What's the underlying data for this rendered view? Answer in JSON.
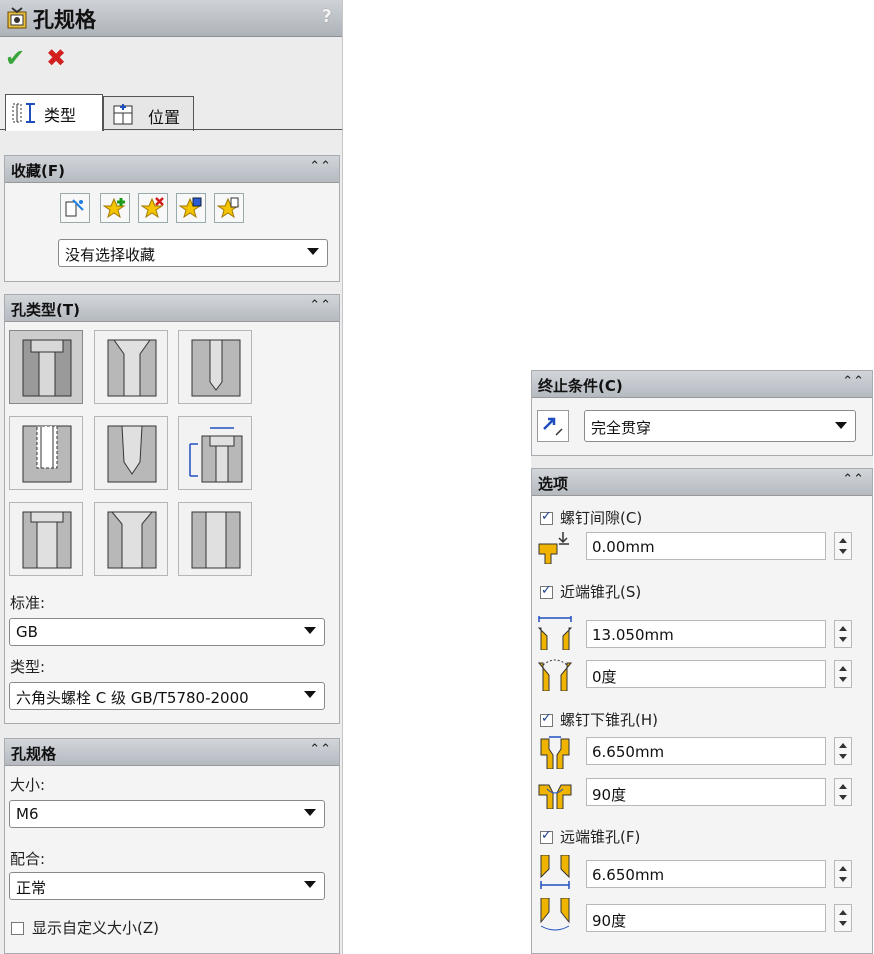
{
  "title": "孔规格",
  "help": "?",
  "tabs": [
    {
      "label": "类型"
    },
    {
      "label": "位置"
    }
  ],
  "favorites": {
    "title": "收藏(F)",
    "select_value": "没有选择收藏"
  },
  "hole_type": {
    "title": "孔类型(T)",
    "standard_label": "标准:",
    "standard_value": "GB",
    "type_label": "类型:",
    "type_value": "六角头螺栓 C 级 GB/T5780-2000"
  },
  "hole_spec": {
    "title": "孔规格",
    "size_label": "大小:",
    "size_value": "M6",
    "fit_label": "配合:",
    "fit_value": "正常",
    "custom_size_label": "显示自定义大小(Z)",
    "custom_size_checked": false
  },
  "end_condition": {
    "title": "终止条件(C)",
    "value": "完全贯穿"
  },
  "options": {
    "title": "选项",
    "head_clearance_label": "螺钉间隙(C)",
    "head_clearance_checked": true,
    "head_clearance_value": "0.00mm",
    "near_csk_label": "近端锥孔(S)",
    "near_csk_checked": true,
    "near_csk_dia": "13.050mm",
    "near_csk_angle": "0度",
    "under_head_csk_label": "螺钉下锥孔(H)",
    "under_head_csk_checked": true,
    "under_head_csk_dia": "6.650mm",
    "under_head_csk_angle": "90度",
    "far_csk_label": "远端锥孔(F)",
    "far_csk_checked": true,
    "far_csk_dia": "6.650mm",
    "far_csk_angle": "90度"
  },
  "colors": {
    "accent_yellow": "#f0b400",
    "ok_green": "#3aa53a",
    "cancel_red": "#d22020"
  }
}
